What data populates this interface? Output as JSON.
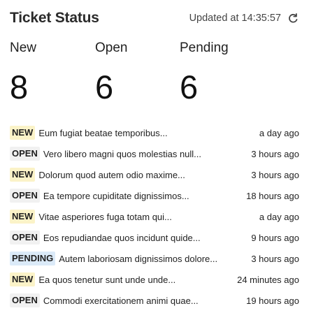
{
  "widget": {
    "title": "Ticket Status",
    "updated_label": "Updated at 14:35:57",
    "refresh_icon": "refresh-icon"
  },
  "stats": [
    {
      "label": "New",
      "value": "8"
    },
    {
      "label": "Open",
      "value": "6"
    },
    {
      "label": "Pending",
      "value": "6"
    }
  ],
  "tickets": [
    {
      "status": "NEW",
      "subject": "Eum fugiat beatae temporibus...",
      "time": "a day ago"
    },
    {
      "status": "OPEN",
      "subject": "Vero libero magni quos molestias null...",
      "time": "3 hours ago"
    },
    {
      "status": "NEW",
      "subject": "Dolorum quod autem odio maxime...",
      "time": "3 hours ago"
    },
    {
      "status": "OPEN",
      "subject": "Ea tempore cupiditate dignissimos...",
      "time": "18 hours ago"
    },
    {
      "status": "NEW",
      "subject": "Vitae asperiores fuga totam qui...",
      "time": "a day ago"
    },
    {
      "status": "OPEN",
      "subject": "Eos repudiandae quos incidunt quide...",
      "time": "9 hours ago"
    },
    {
      "status": "PENDING",
      "subject": "Autem laboriosam dignissimos dolore...",
      "time": "3 hours ago"
    },
    {
      "status": "NEW",
      "subject": "Ea quos tenetur sunt unde unde...",
      "time": "24 minutes ago"
    },
    {
      "status": "OPEN",
      "subject": "Commodi exercitationem animi quae...",
      "time": "19 hours ago"
    }
  ],
  "colors": {
    "new_badge": "#fbf3c8",
    "open_badge": "#f1f1f1",
    "pending_badge": "#dbeaf8",
    "text": "#222222"
  }
}
